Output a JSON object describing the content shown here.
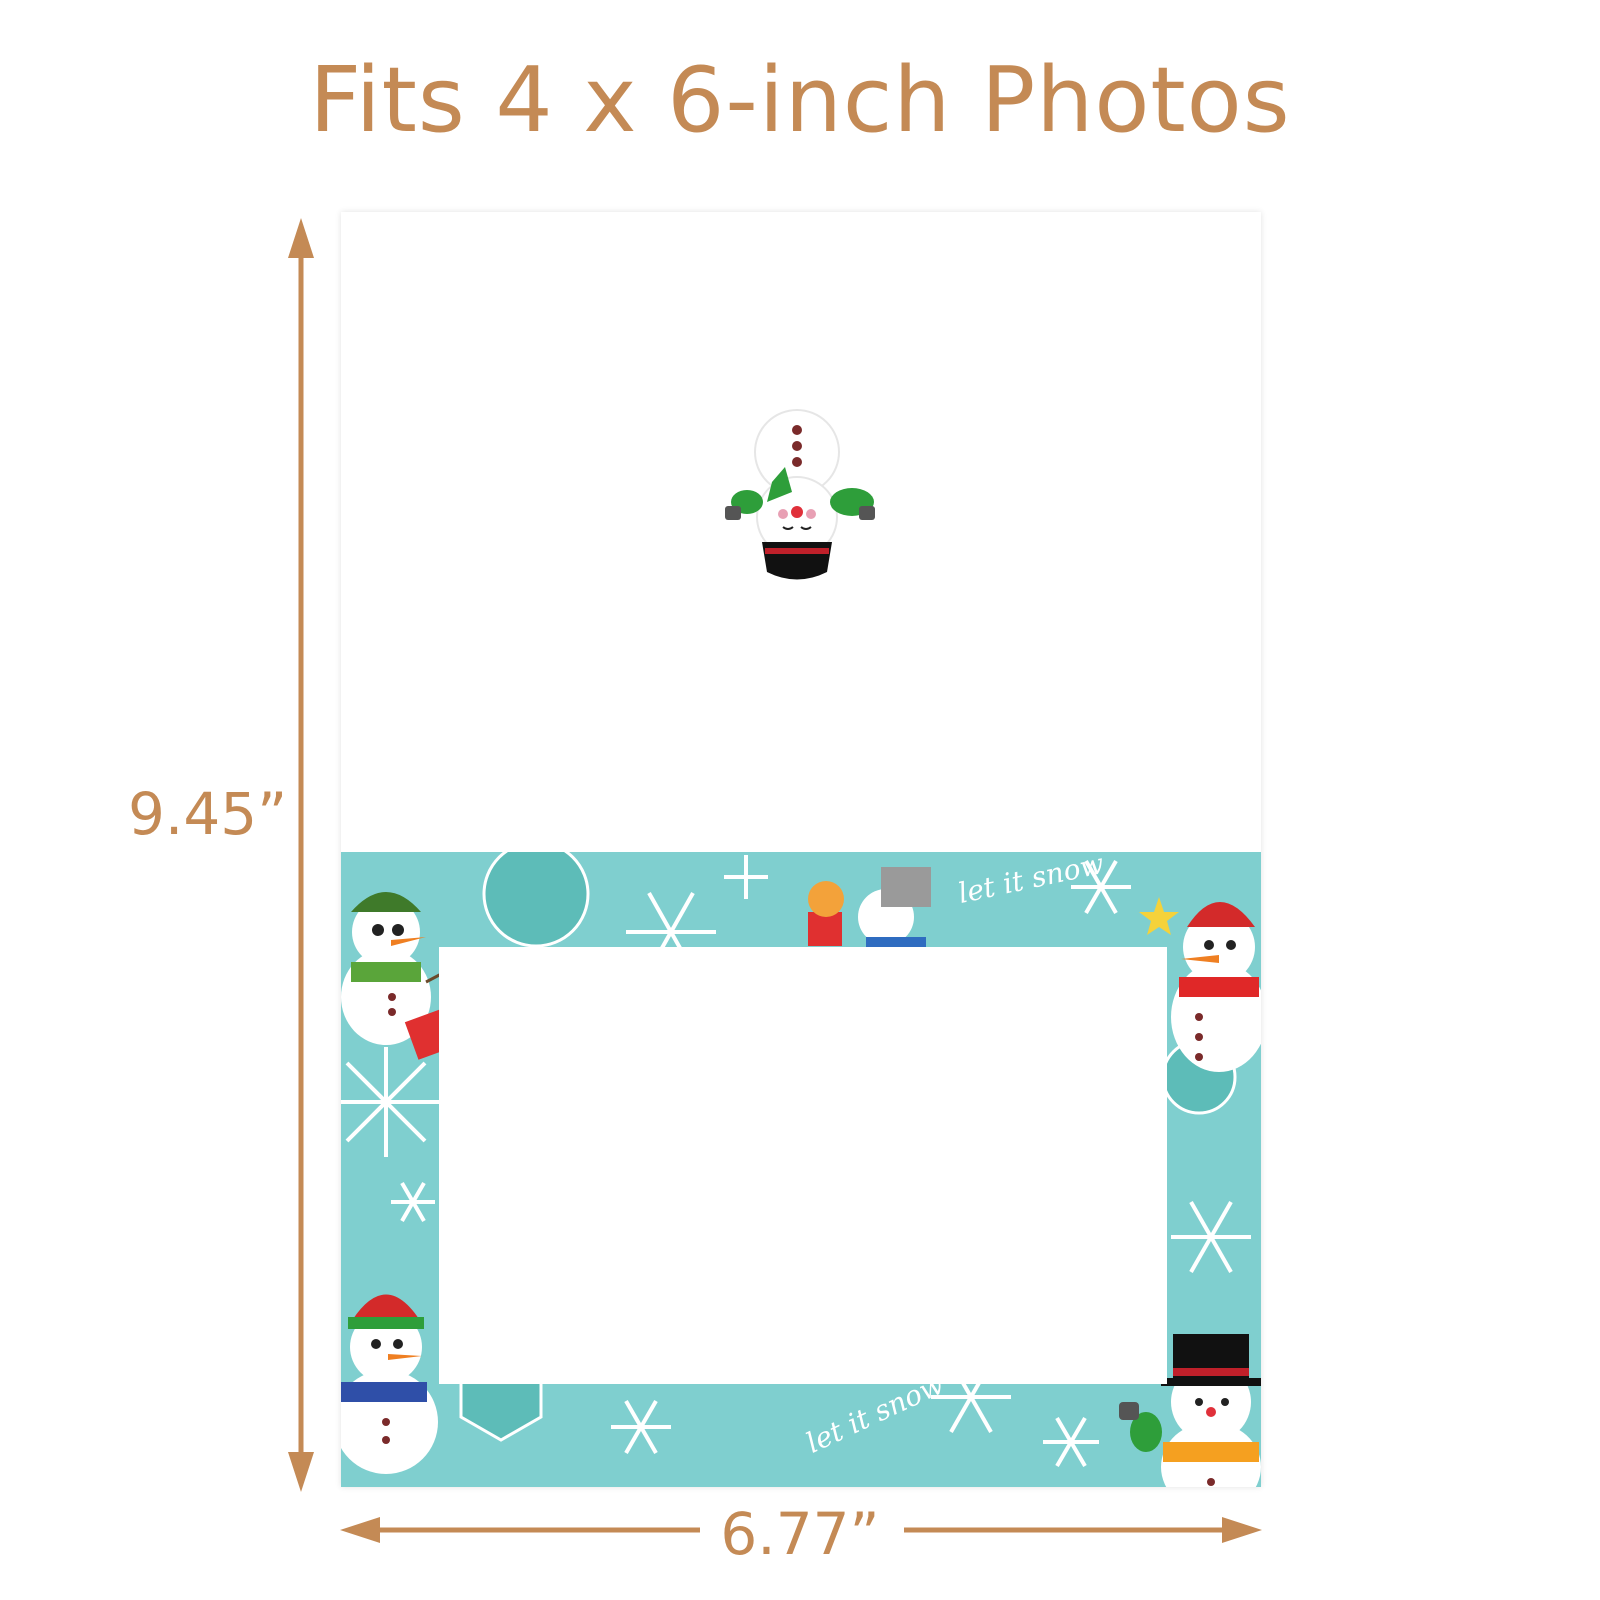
{
  "title": "Fits 4 x 6-inch Photos",
  "dimensions": {
    "height_label": "9.45”",
    "width_label": "6.77”"
  },
  "frame": {
    "phrases": [
      "let it snow",
      "let it snow"
    ]
  },
  "colors": {
    "accent": "#c48a55",
    "frame_bg": "#7fcfcf",
    "snow": "#ffffff"
  }
}
